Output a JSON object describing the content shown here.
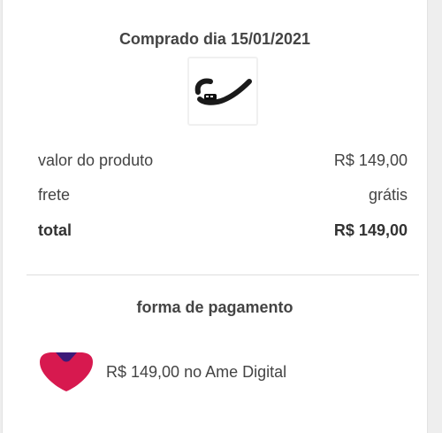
{
  "order": {
    "purchase_date": "Comprado dia 15/01/2021",
    "product_image_icon": "fitness-band-icon"
  },
  "summary": {
    "rows": [
      {
        "label": "valor do produto",
        "value": "R$ 149,00"
      },
      {
        "label": "frete",
        "value": "grátis"
      },
      {
        "label": "total",
        "value": "R$ 149,00"
      }
    ]
  },
  "payment": {
    "title": "forma de pagamento",
    "method_icon": "ame-digital-logo-icon",
    "description": "R$ 149,00 no Ame Digital",
    "colors": {
      "logo_primary": "#d7194f",
      "logo_secondary": "#3c1a78"
    }
  }
}
